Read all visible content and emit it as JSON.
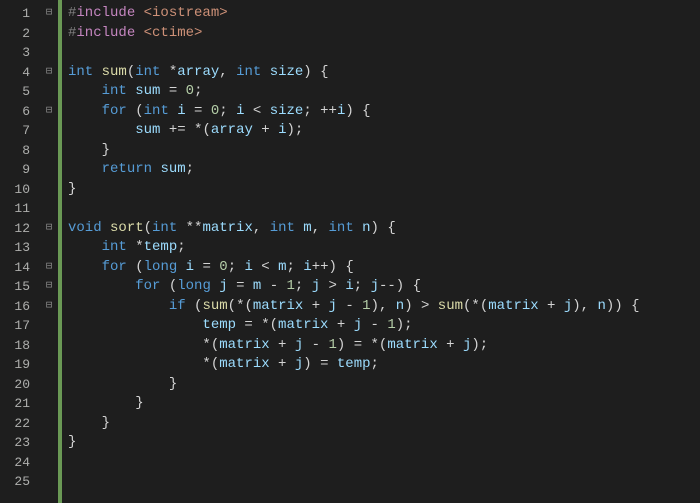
{
  "lines": [
    {
      "num": 1,
      "fold": "⊟",
      "tokens": [
        [
          "hash",
          "#"
        ],
        [
          "pp",
          "include "
        ],
        [
          "inc",
          "<iostream>"
        ]
      ]
    },
    {
      "num": 2,
      "fold": "",
      "tokens": [
        [
          "hash",
          "#"
        ],
        [
          "pp",
          "include "
        ],
        [
          "inc",
          "<ctime>"
        ]
      ]
    },
    {
      "num": 3,
      "fold": "",
      "tokens": []
    },
    {
      "num": 4,
      "fold": "⊟",
      "tokens": [
        [
          "ty",
          "int "
        ],
        [
          "fn",
          "sum"
        ],
        [
          "pl",
          "("
        ],
        [
          "ty",
          "int "
        ],
        [
          "pl",
          "*"
        ],
        [
          "pr",
          "array"
        ],
        [
          "pl",
          ", "
        ],
        [
          "ty",
          "int "
        ],
        [
          "pr",
          "size"
        ],
        [
          "pl",
          ") {"
        ]
      ]
    },
    {
      "num": 5,
      "fold": "",
      "tokens": [
        [
          "pl",
          "    "
        ],
        [
          "ty",
          "int "
        ],
        [
          "id",
          "sum"
        ],
        [
          "pl",
          " = "
        ],
        [
          "num",
          "0"
        ],
        [
          "pl",
          ";"
        ]
      ]
    },
    {
      "num": 6,
      "fold": "⊟",
      "tokens": [
        [
          "pl",
          "    "
        ],
        [
          "kw",
          "for"
        ],
        [
          "pl",
          " ("
        ],
        [
          "ty",
          "int "
        ],
        [
          "id",
          "i"
        ],
        [
          "pl",
          " = "
        ],
        [
          "num",
          "0"
        ],
        [
          "pl",
          "; "
        ],
        [
          "id",
          "i"
        ],
        [
          "pl",
          " < "
        ],
        [
          "id",
          "size"
        ],
        [
          "pl",
          "; ++"
        ],
        [
          "id",
          "i"
        ],
        [
          "pl",
          ") {"
        ]
      ]
    },
    {
      "num": 7,
      "fold": "",
      "tokens": [
        [
          "pl",
          "        "
        ],
        [
          "id",
          "sum"
        ],
        [
          "pl",
          " += *("
        ],
        [
          "id",
          "array"
        ],
        [
          "pl",
          " + "
        ],
        [
          "id",
          "i"
        ],
        [
          "pl",
          ");"
        ]
      ]
    },
    {
      "num": 8,
      "fold": "",
      "tokens": [
        [
          "pl",
          "    }"
        ]
      ]
    },
    {
      "num": 9,
      "fold": "",
      "tokens": [
        [
          "pl",
          "    "
        ],
        [
          "kw",
          "return"
        ],
        [
          "pl",
          " "
        ],
        [
          "id",
          "sum"
        ],
        [
          "pl",
          ";"
        ]
      ]
    },
    {
      "num": 10,
      "fold": "",
      "tokens": [
        [
          "pl",
          "}"
        ]
      ]
    },
    {
      "num": 11,
      "fold": "",
      "tokens": []
    },
    {
      "num": 12,
      "fold": "⊟",
      "tokens": [
        [
          "ty",
          "void "
        ],
        [
          "fn",
          "sort"
        ],
        [
          "pl",
          "("
        ],
        [
          "ty",
          "int "
        ],
        [
          "pl",
          "**"
        ],
        [
          "pr",
          "matrix"
        ],
        [
          "pl",
          ", "
        ],
        [
          "ty",
          "int "
        ],
        [
          "pr",
          "m"
        ],
        [
          "pl",
          ", "
        ],
        [
          "ty",
          "int "
        ],
        [
          "pr",
          "n"
        ],
        [
          "pl",
          ") {"
        ]
      ]
    },
    {
      "num": 13,
      "fold": "",
      "tokens": [
        [
          "pl",
          "    "
        ],
        [
          "ty",
          "int "
        ],
        [
          "pl",
          "*"
        ],
        [
          "id",
          "temp"
        ],
        [
          "pl",
          ";"
        ]
      ]
    },
    {
      "num": 14,
      "fold": "⊟",
      "tokens": [
        [
          "pl",
          "    "
        ],
        [
          "kw",
          "for"
        ],
        [
          "pl",
          " ("
        ],
        [
          "ty",
          "long "
        ],
        [
          "id",
          "i"
        ],
        [
          "pl",
          " = "
        ],
        [
          "num",
          "0"
        ],
        [
          "pl",
          "; "
        ],
        [
          "id",
          "i"
        ],
        [
          "pl",
          " < "
        ],
        [
          "id",
          "m"
        ],
        [
          "pl",
          "; "
        ],
        [
          "id",
          "i"
        ],
        [
          "pl",
          "++) {"
        ]
      ]
    },
    {
      "num": 15,
      "fold": "⊟",
      "tokens": [
        [
          "pl",
          "        "
        ],
        [
          "kw",
          "for"
        ],
        [
          "pl",
          " ("
        ],
        [
          "ty",
          "long "
        ],
        [
          "id",
          "j"
        ],
        [
          "pl",
          " = "
        ],
        [
          "id",
          "m"
        ],
        [
          "pl",
          " - "
        ],
        [
          "num",
          "1"
        ],
        [
          "pl",
          "; "
        ],
        [
          "id",
          "j"
        ],
        [
          "pl",
          " > "
        ],
        [
          "id",
          "i"
        ],
        [
          "pl",
          "; "
        ],
        [
          "id",
          "j"
        ],
        [
          "pl",
          "--) {"
        ]
      ]
    },
    {
      "num": 16,
      "fold": "⊟",
      "tokens": [
        [
          "pl",
          "            "
        ],
        [
          "kw",
          "if"
        ],
        [
          "pl",
          " ("
        ],
        [
          "fn",
          "sum"
        ],
        [
          "pl",
          "(*("
        ],
        [
          "id",
          "matrix"
        ],
        [
          "pl",
          " + "
        ],
        [
          "id",
          "j"
        ],
        [
          "pl",
          " - "
        ],
        [
          "num",
          "1"
        ],
        [
          "pl",
          "), "
        ],
        [
          "id",
          "n"
        ],
        [
          "pl",
          ") > "
        ],
        [
          "fn",
          "sum"
        ],
        [
          "pl",
          "(*("
        ],
        [
          "id",
          "matrix"
        ],
        [
          "pl",
          " + "
        ],
        [
          "id",
          "j"
        ],
        [
          "pl",
          "), "
        ],
        [
          "id",
          "n"
        ],
        [
          "pl",
          ")) {"
        ]
      ]
    },
    {
      "num": 17,
      "fold": "",
      "tokens": [
        [
          "pl",
          "                "
        ],
        [
          "id",
          "temp"
        ],
        [
          "pl",
          " = *("
        ],
        [
          "id",
          "matrix"
        ],
        [
          "pl",
          " + "
        ],
        [
          "id",
          "j"
        ],
        [
          "pl",
          " - "
        ],
        [
          "num",
          "1"
        ],
        [
          "pl",
          ");"
        ]
      ]
    },
    {
      "num": 18,
      "fold": "",
      "tokens": [
        [
          "pl",
          "                *("
        ],
        [
          "id",
          "matrix"
        ],
        [
          "pl",
          " + "
        ],
        [
          "id",
          "j"
        ],
        [
          "pl",
          " - "
        ],
        [
          "num",
          "1"
        ],
        [
          "pl",
          ") = *("
        ],
        [
          "id",
          "matrix"
        ],
        [
          "pl",
          " + "
        ],
        [
          "id",
          "j"
        ],
        [
          "pl",
          ");"
        ]
      ]
    },
    {
      "num": 19,
      "fold": "",
      "tokens": [
        [
          "pl",
          "                *("
        ],
        [
          "id",
          "matrix"
        ],
        [
          "pl",
          " + "
        ],
        [
          "id",
          "j"
        ],
        [
          "pl",
          ") = "
        ],
        [
          "id",
          "temp"
        ],
        [
          "pl",
          ";"
        ]
      ]
    },
    {
      "num": 20,
      "fold": "",
      "tokens": [
        [
          "pl",
          "            }"
        ]
      ]
    },
    {
      "num": 21,
      "fold": "",
      "tokens": [
        [
          "pl",
          "        }"
        ]
      ]
    },
    {
      "num": 22,
      "fold": "",
      "tokens": [
        [
          "pl",
          "    }"
        ]
      ]
    },
    {
      "num": 23,
      "fold": "",
      "tokens": [
        [
          "pl",
          "}"
        ]
      ]
    },
    {
      "num": 24,
      "fold": "",
      "tokens": []
    },
    {
      "num": 25,
      "fold": "",
      "tokens": []
    }
  ]
}
